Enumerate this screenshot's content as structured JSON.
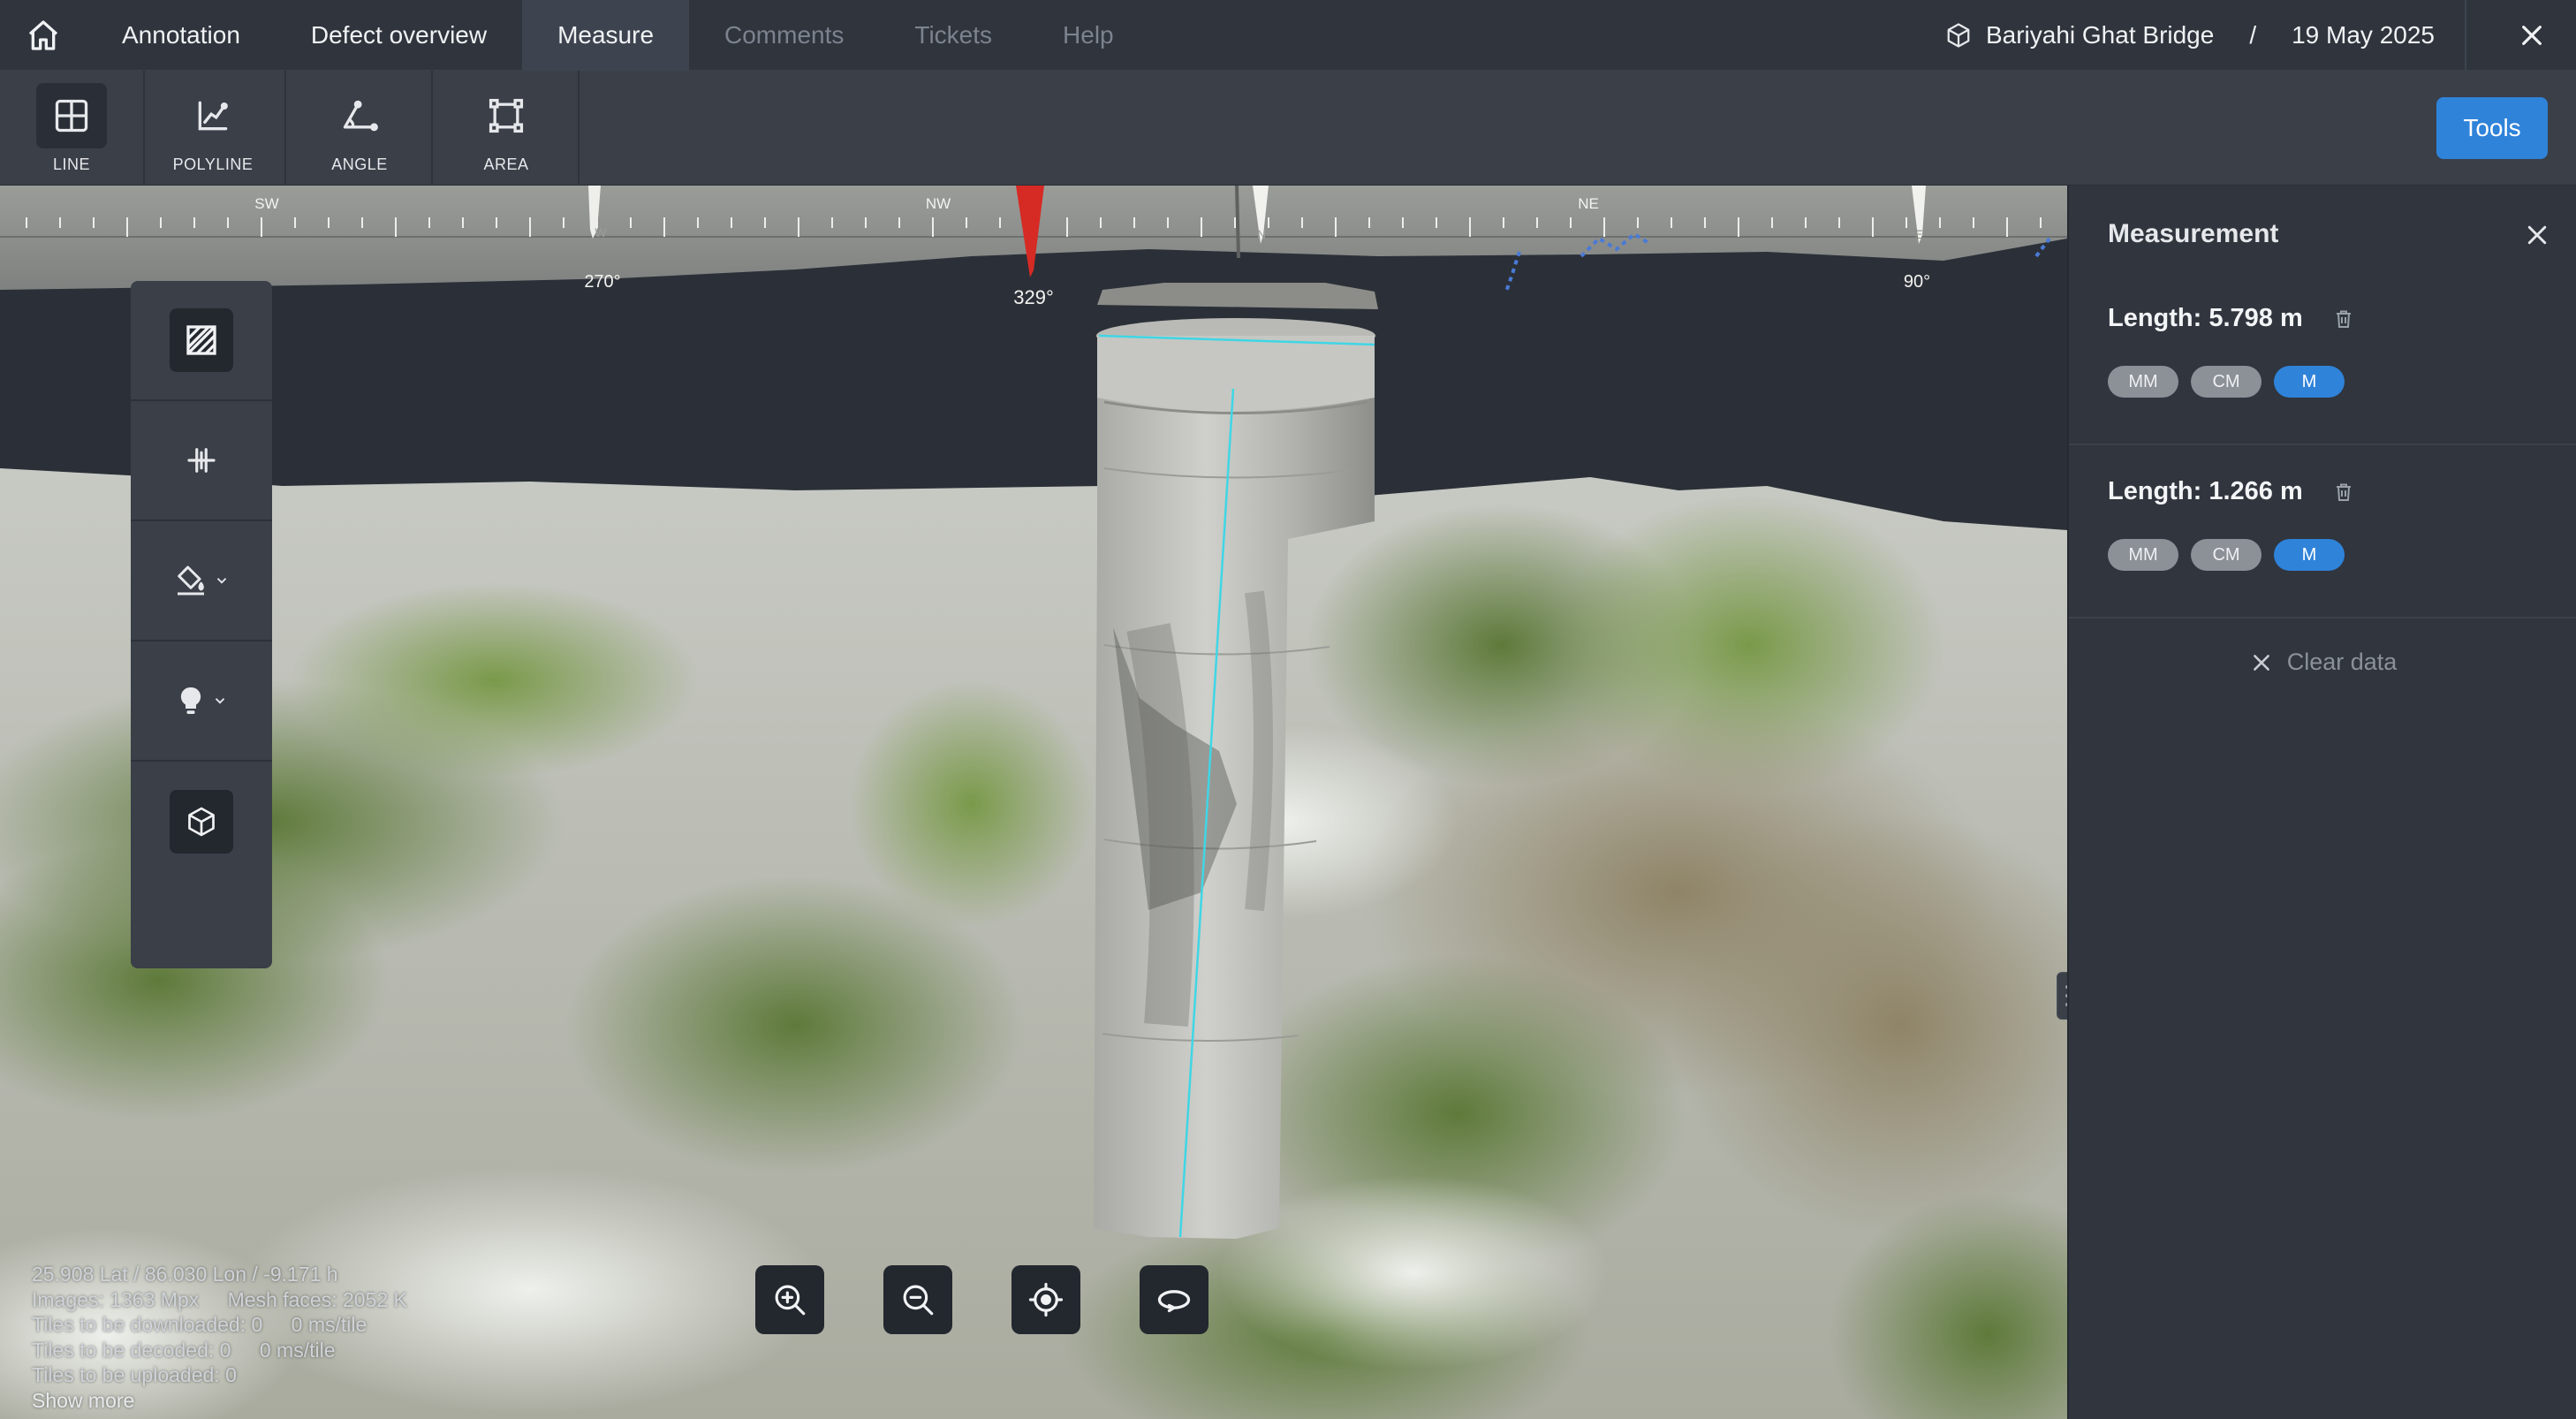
{
  "nav": {
    "tabs": [
      {
        "label": "Annotation",
        "state": "normal"
      },
      {
        "label": "Defect overview",
        "state": "normal"
      },
      {
        "label": "Measure",
        "state": "active"
      },
      {
        "label": "Comments",
        "state": "disabled"
      },
      {
        "label": "Tickets",
        "state": "disabled"
      },
      {
        "label": "Help",
        "state": "disabled"
      }
    ],
    "project_name": "Bariyahi Ghat Bridge",
    "separator": "/",
    "date": "19 May 2025"
  },
  "toolbar": {
    "tools": [
      {
        "label": "LINE",
        "icon": "line-grid-icon",
        "active": true
      },
      {
        "label": "POLYLINE",
        "icon": "polyline-icon",
        "active": false
      },
      {
        "label": "ANGLE",
        "icon": "angle-icon",
        "active": false
      },
      {
        "label": "AREA",
        "icon": "area-icon",
        "active": false
      }
    ],
    "tools_button": "Tools"
  },
  "viewport": {
    "compass": {
      "labels": [
        "SW",
        "NW",
        "NE"
      ],
      "degrees": [
        "270°",
        "329°",
        "90°"
      ],
      "markers": [
        "W",
        "N",
        "E"
      ]
    },
    "stats": {
      "coords": "25.908 Lat / 86.030 Lon / -9.171 h",
      "images": "Images: 1363 Mpx",
      "mesh": "Mesh faces: 2052 K",
      "download": "Tiles to be downloaded: 0",
      "download_rate": "0 ms/tile",
      "decode": "Tiles to be decoded: 0",
      "decode_rate": "0 ms/tile",
      "upload": "Tiles to be uploaded: 0",
      "show_more": "Show more"
    }
  },
  "measurement_panel": {
    "title": "Measurement",
    "items": [
      {
        "length": "Length: 5.798 m",
        "units": [
          "MM",
          "CM",
          "M"
        ],
        "active_unit": "M"
      },
      {
        "length": "Length: 1.266 m",
        "units": [
          "MM",
          "CM",
          "M"
        ],
        "active_unit": "M"
      }
    ],
    "clear_label": "Clear data"
  },
  "colors": {
    "accent": "#2f83d9",
    "measure_line": "#3fd6e6",
    "compass_north": "#d62a24"
  }
}
